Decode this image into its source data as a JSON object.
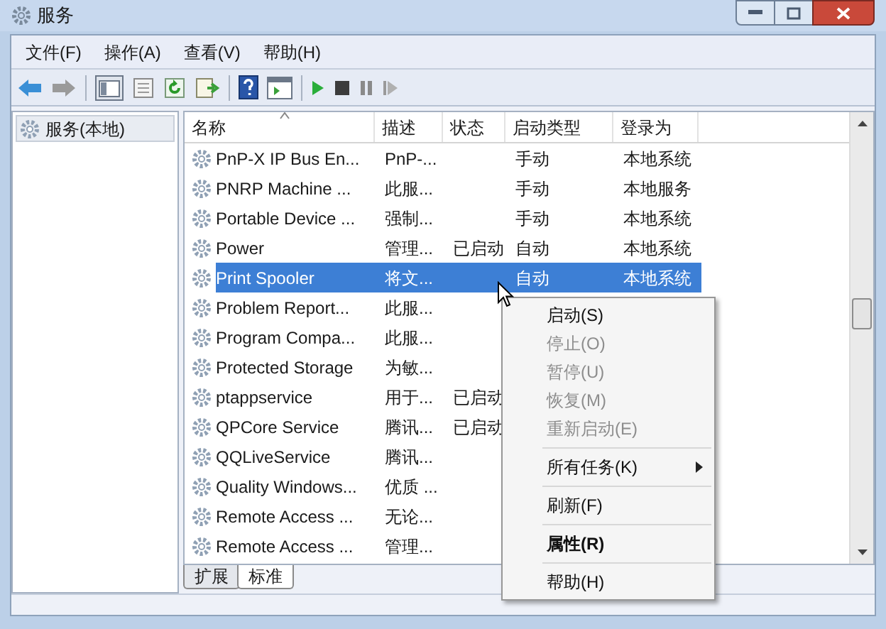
{
  "window": {
    "title": "服务"
  },
  "menu_bar": [
    {
      "label": "文件(F)"
    },
    {
      "label": "操作(A)"
    },
    {
      "label": "查看(V)"
    },
    {
      "label": "帮助(H)"
    }
  ],
  "tree": {
    "items": [
      {
        "label": "服务(本地)",
        "selected": true
      }
    ]
  },
  "table": {
    "columns": [
      {
        "label": "名称",
        "sorted": true
      },
      {
        "label": "描述",
        "sorted": false
      },
      {
        "label": "状态",
        "sorted": false
      },
      {
        "label": "启动类型",
        "sorted": false
      },
      {
        "label": "登录为",
        "sorted": false
      }
    ],
    "rows": [
      {
        "name": "PnP-X IP Bus En...",
        "description": "PnP-...",
        "startup_type": "手动",
        "log_on_as": "本地系统",
        "selected": false
      },
      {
        "name": "PNRP Machine ...",
        "description": "此服...",
        "startup_type": "手动",
        "log_on_as": "本地服务",
        "selected": false
      },
      {
        "name": "Portable Device ...",
        "description": "强制...",
        "startup_type": "手动",
        "log_on_as": "本地系统",
        "selected": false
      },
      {
        "name": "Power",
        "description": "管理...",
        "status": "已启动",
        "startup_type": "自动",
        "log_on_as": "本地系统",
        "selected": false
      },
      {
        "name": "Print Spooler",
        "description": "将文...",
        "startup_type": "自动",
        "log_on_as": "本地系统",
        "selected": true
      },
      {
        "name": "Problem Report...",
        "description": "此服...",
        "selected": false
      },
      {
        "name": "Program Compa...",
        "description": "此服...",
        "selected": false
      },
      {
        "name": "Protected Storage",
        "description": "为敏...",
        "selected": false
      },
      {
        "name": "ptappservice",
        "description": "用于...",
        "status": "已启动",
        "selected": false
      },
      {
        "name": "QPCore Service",
        "description": "腾讯...",
        "status": "已启动",
        "selected": false
      },
      {
        "name": "QQLiveService",
        "description": "腾讯...",
        "selected": false
      },
      {
        "name": "Quality Windows...",
        "description": "优质 ...",
        "selected": false
      },
      {
        "name": "Remote Access ...",
        "description": "无论...",
        "selected": false
      },
      {
        "name": "Remote Access ...",
        "description": "管理...",
        "selected": false
      }
    ]
  },
  "view_tabs": [
    {
      "label": "扩展",
      "selected": false
    },
    {
      "label": "标准",
      "selected": true
    }
  ],
  "context_menu": [
    {
      "kind": "item",
      "label": "启动(S)",
      "disabled": false,
      "bold": false,
      "submenu": false
    },
    {
      "kind": "item",
      "label": "停止(O)",
      "disabled": true,
      "bold": false,
      "submenu": false
    },
    {
      "kind": "item",
      "label": "暂停(U)",
      "disabled": true,
      "bold": false,
      "submenu": false
    },
    {
      "kind": "item",
      "label": "恢复(M)",
      "disabled": true,
      "bold": false,
      "submenu": false
    },
    {
      "kind": "item",
      "label": "重新启动(E)",
      "disabled": true,
      "bold": false,
      "submenu": false
    },
    {
      "kind": "separator"
    },
    {
      "kind": "item",
      "label": "所有任务(K)",
      "disabled": false,
      "bold": false,
      "submenu": true
    },
    {
      "kind": "separator"
    },
    {
      "kind": "item",
      "label": "刷新(F)",
      "disabled": false,
      "bold": false,
      "submenu": false
    },
    {
      "kind": "separator"
    },
    {
      "kind": "item",
      "label": "属性(R)",
      "disabled": false,
      "bold": true,
      "submenu": false
    },
    {
      "kind": "separator"
    },
    {
      "kind": "item",
      "label": "帮助(H)",
      "disabled": false,
      "bold": false,
      "submenu": false
    }
  ]
}
